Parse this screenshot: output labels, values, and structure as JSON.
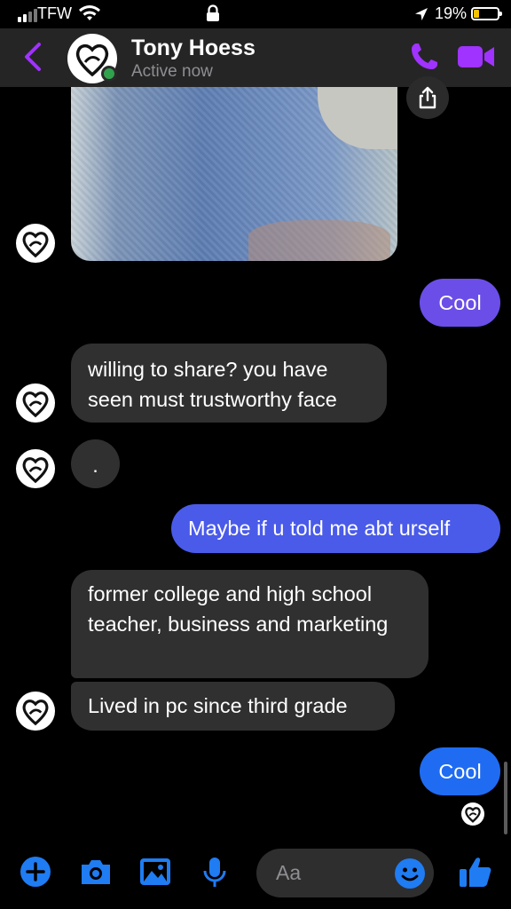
{
  "status_bar": {
    "carrier": "TFW",
    "battery": "19%"
  },
  "header": {
    "name": "Tony Hoess",
    "status": "Active now"
  },
  "messages": [
    {
      "from": "me",
      "text": "Cool"
    },
    {
      "from": "them",
      "text": "willing to share?  you have seen must trustworthy face"
    },
    {
      "from": "them",
      "text": "."
    },
    {
      "from": "me",
      "text": "Maybe if u told me abt urself"
    },
    {
      "from": "them",
      "text": "former college and high school teacher, business and marketing"
    },
    {
      "from": "them",
      "text": "Lived in pc since third grade"
    },
    {
      "from": "me",
      "text": "Cool"
    }
  ],
  "composer": {
    "placeholder": "Aa"
  },
  "colors": {
    "accent": "#a033ff",
    "bubble_purple": "#6b4ee8",
    "bubble_indigo": "#4a5be9",
    "bubble_blue": "#1f6cf2",
    "composer_icons": "#1f7cf2",
    "online": "#31a24c"
  },
  "icons": [
    "signal-icon",
    "wifi-icon",
    "lock-icon",
    "location-icon",
    "battery-icon",
    "back-chevron-icon",
    "phone-icon",
    "video-camera-icon",
    "share-icon",
    "plus-icon",
    "camera-icon",
    "image-icon",
    "microphone-icon",
    "emoji-icon",
    "thumbs-up-icon"
  ]
}
